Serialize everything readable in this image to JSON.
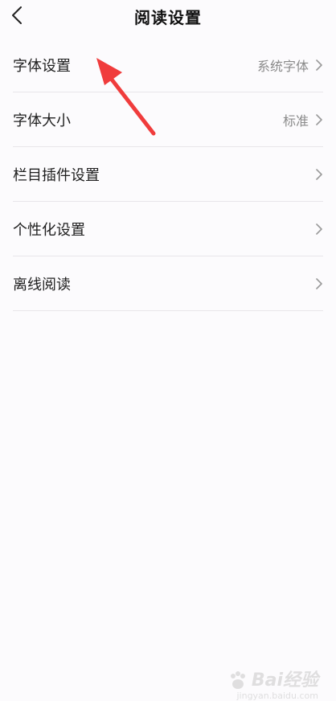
{
  "header": {
    "title": "阅读设置"
  },
  "settings": [
    {
      "label": "字体设置",
      "value": "系统字体"
    },
    {
      "label": "字体大小",
      "value": "标准"
    },
    {
      "label": "栏目插件设置",
      "value": ""
    },
    {
      "label": "个性化设置",
      "value": ""
    },
    {
      "label": "离线阅读",
      "value": ""
    }
  ],
  "annotation": {
    "color": "#f03c3c"
  },
  "watermark": {
    "brand": "Bai经验",
    "url": "jingyan.baidu.com"
  }
}
